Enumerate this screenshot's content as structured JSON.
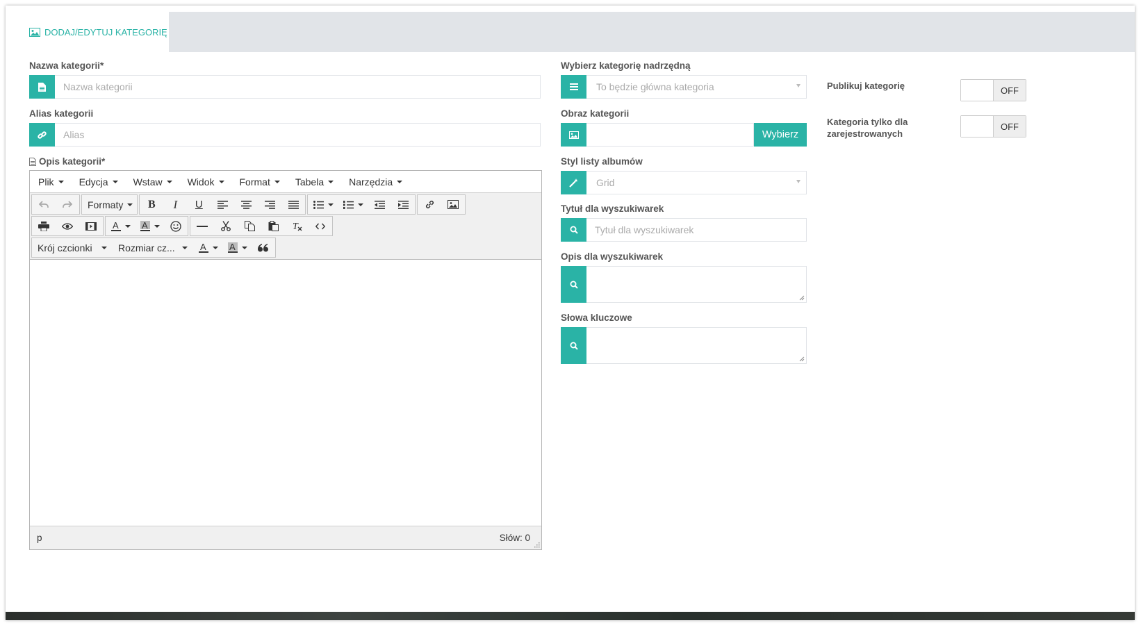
{
  "tab": {
    "label": "DODAJ/EDYTUJ KATEGORIĘ",
    "icon": "image-icon"
  },
  "left": {
    "name_label": "Nazwa kategorii*",
    "name_placeholder": "Nazwa kategorii",
    "alias_label": "Alias kategorii",
    "alias_placeholder": "Alias",
    "desc_label": "Opis kategorii*"
  },
  "editor": {
    "menus": [
      "Plik",
      "Edycja",
      "Wstaw",
      "Widok",
      "Format",
      "Tabela",
      "Narzędzia"
    ],
    "formats_label": "Formaty",
    "font_family_label": "Krój czcionki",
    "font_size_label": "Rozmiar cz...",
    "status_path": "p",
    "word_count": "Słów: 0"
  },
  "middle": {
    "parent_label": "Wybierz kategorię nadrzędną",
    "parent_value": "To będzie główna kategoria",
    "image_label": "Obraz kategorii",
    "image_button": "Wybierz",
    "album_style_label": "Styl listy albumów",
    "album_style_value": "Grid",
    "seo_title_label": "Tytuł dla wyszukiwarek",
    "seo_title_placeholder": "Tytuł dla wyszukiwarek",
    "seo_desc_label": "Opis dla wyszukiwarek",
    "keywords_label": "Słowa kluczowe"
  },
  "right": {
    "publish_label": "Publikuj kategorię",
    "publish_state": "OFF",
    "registered_label_1": "Kategoria tylko dla",
    "registered_label_2": "zarejestrowanych",
    "registered_state": "OFF"
  },
  "colors": {
    "accent": "#2ab3a6",
    "tabbar": "#e1e4e8"
  }
}
